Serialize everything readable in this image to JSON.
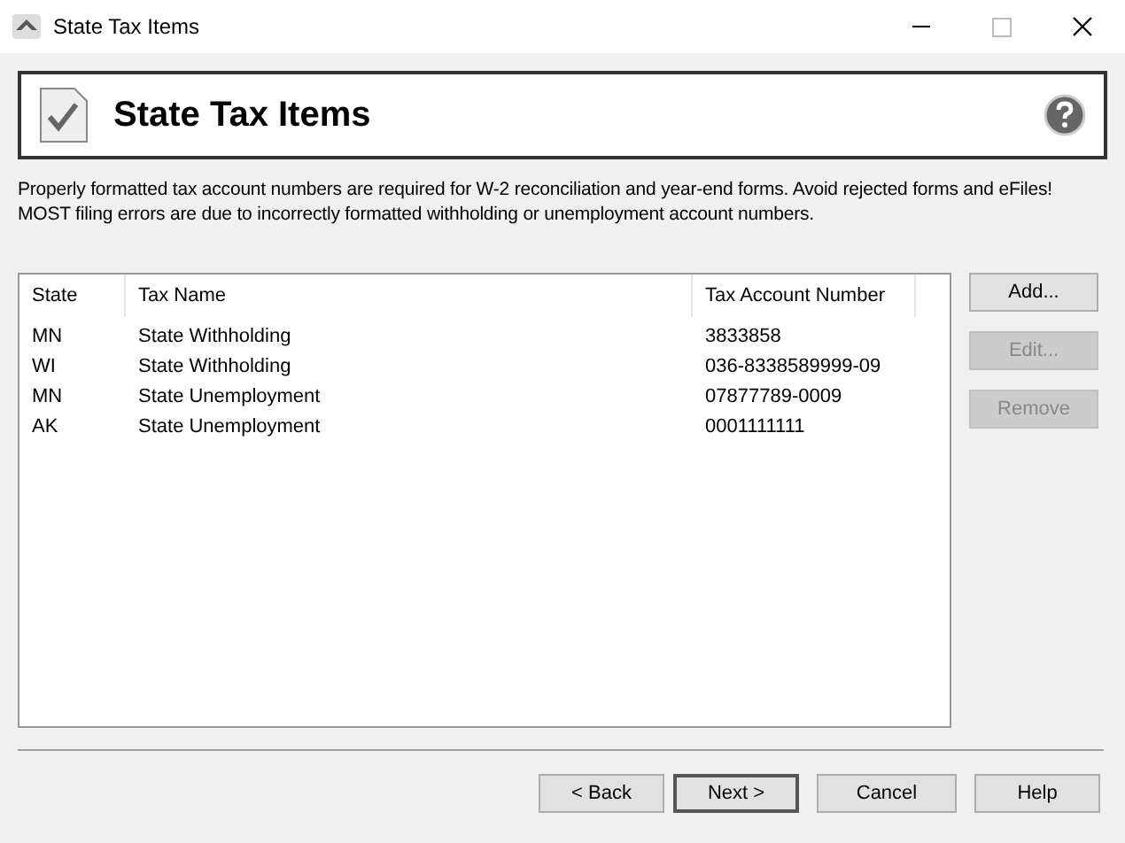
{
  "window": {
    "title": "State Tax Items"
  },
  "header": {
    "title": "State Tax Items"
  },
  "description": "Properly formatted tax account numbers are required for W-2 reconciliation and year-end forms. Avoid rejected forms and eFiles! MOST filing errors are due to incorrectly formatted withholding or unemployment account numbers.",
  "table": {
    "columns": [
      "State",
      "Tax Name",
      "Tax Account Number"
    ],
    "rows": [
      [
        "MN",
        "State Withholding",
        "3833858"
      ],
      [
        "WI",
        "State Withholding",
        "036-8338589999-09"
      ],
      [
        "MN",
        "State Unemployment",
        "07877789-0009"
      ],
      [
        "AK",
        "State Unemployment",
        "0001111111"
      ]
    ]
  },
  "side_buttons": [
    {
      "label": "Add...",
      "disabled": false
    },
    {
      "label": "Edit...",
      "disabled": true
    },
    {
      "label": "Remove",
      "disabled": true
    }
  ],
  "footer_buttons": [
    {
      "label": "< Back",
      "default": false
    },
    {
      "label": "Next >",
      "default": true
    },
    {
      "label": "Cancel",
      "default": false
    },
    {
      "label": "Help",
      "default": false
    }
  ]
}
